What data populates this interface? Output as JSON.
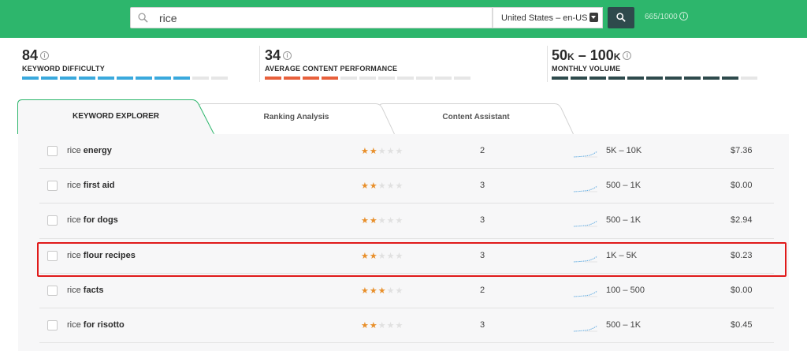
{
  "search": {
    "query": "rice",
    "locale": "United States – en-US",
    "quota": "665/1000"
  },
  "metrics": [
    {
      "value": "84",
      "unit_1": "",
      "unit_2": "",
      "value_2": "",
      "label": "KEYWORD DIFFICULTY",
      "level": 0.84,
      "color": "#3aa9dd"
    },
    {
      "value": "34",
      "unit_1": "",
      "unit_2": "",
      "value_2": "",
      "label": "AVERAGE CONTENT PERFORMANCE",
      "level": 0.34,
      "color": "#e8603c"
    },
    {
      "value": "50",
      "unit_1": "K",
      "sep": " – ",
      "value_2": "100",
      "unit_2": "K",
      "label": "MONTHLY VOLUME",
      "level": 0.9,
      "color": "#2e4a4c"
    }
  ],
  "tabs": [
    {
      "label": "KEYWORD EXPLORER",
      "active": true
    },
    {
      "label": "Ranking Analysis",
      "active": false
    },
    {
      "label": "Content Assistant",
      "active": false
    }
  ],
  "rows": [
    {
      "prefix": "rice",
      "suffix": "energy",
      "stars": 2,
      "difficulty": "2",
      "volume": "5K – 10K",
      "cpc": "$7.36"
    },
    {
      "prefix": "rice",
      "suffix": "first aid",
      "stars": 2,
      "difficulty": "3",
      "volume": "500 – 1K",
      "cpc": "$0.00"
    },
    {
      "prefix": "rice",
      "suffix": "for dogs",
      "stars": 2,
      "difficulty": "3",
      "volume": "500 – 1K",
      "cpc": "$2.94"
    },
    {
      "prefix": "rice",
      "suffix": "flour recipes",
      "stars": 2,
      "difficulty": "3",
      "volume": "1K – 5K",
      "cpc": "$0.23"
    },
    {
      "prefix": "rice",
      "suffix": "facts",
      "stars": 3,
      "difficulty": "2",
      "volume": "100 – 500",
      "cpc": "$0.00"
    },
    {
      "prefix": "rice",
      "suffix": "for risotto",
      "stars": 2,
      "difficulty": "3",
      "volume": "500 – 1K",
      "cpc": "$0.45"
    }
  ],
  "colors": {
    "brand": "#2db66c",
    "star": "#e88f2a",
    "highlight": "#e01a1a",
    "spark": "#5aa8e0"
  }
}
